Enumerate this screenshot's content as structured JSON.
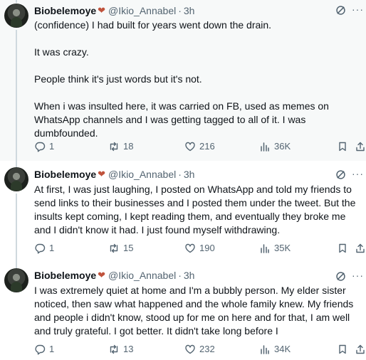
{
  "tweets": [
    {
      "author_name": "Biobelemoye",
      "author_emoji": "❤",
      "handle": "@Ikio_Annabel",
      "time": "3h",
      "paragraphs": [
        "(confidence) I had built for years went down the drain.",
        "It was crazy.",
        "People think it's just words but it's not.",
        "When i was insulted here, it was carried on FB, used as memes on WhatsApp channels and I was getting tagged to all of it. I was dumbfounded."
      ],
      "replies": "1",
      "retweets": "18",
      "likes": "216",
      "views": "36K"
    },
    {
      "author_name": "Biobelemoye",
      "author_emoji": "❤",
      "handle": "@Ikio_Annabel",
      "time": "3h",
      "paragraphs": [
        "At first, I was just laughing, I posted on WhatsApp and told my friends to send links to their businesses and I posted them under the tweet. But the insults kept coming, I kept reading them, and eventually they broke me and I didn't know it had. I just found myself withdrawing."
      ],
      "replies": "1",
      "retweets": "15",
      "likes": "190",
      "views": "35K"
    },
    {
      "author_name": "Biobelemoye",
      "author_emoji": "❤",
      "handle": "@Ikio_Annabel",
      "time": "3h",
      "paragraphs": [
        "I was extremely quiet at home and I'm a bubbly person. My elder sister noticed, then saw what happened and the whole family knew. My friends and people i didn't know, stood up for me on here and for that, I am well and truly grateful. I got better. It didn't take long before I"
      ],
      "replies": "1",
      "retweets": "13",
      "likes": "232",
      "views": "34K"
    }
  ],
  "colors": {
    "text_primary": "#0f1419",
    "text_secondary": "#536471",
    "highlight_bg": "#f7f9f9",
    "thread_line": "#cfd9de",
    "heart": "#c0533c"
  },
  "icons": {
    "reply": "reply-icon",
    "retweet": "retweet-icon",
    "like": "heart-icon",
    "views": "views-icon",
    "bookmark": "bookmark-icon",
    "share": "share-icon",
    "grok": "grok-icon",
    "more": "more-icon"
  }
}
